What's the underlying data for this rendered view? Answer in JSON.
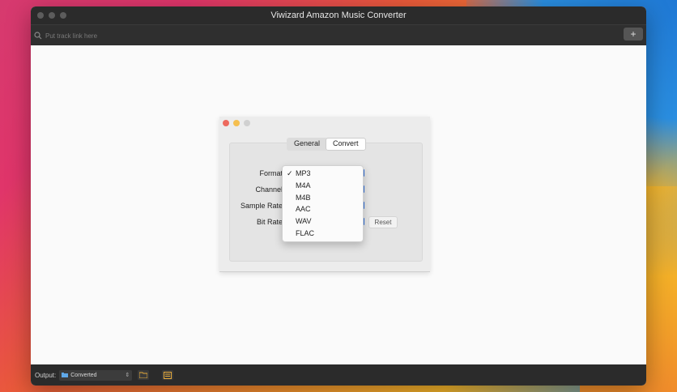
{
  "window": {
    "title": "Viwizard Amazon Music Converter"
  },
  "search": {
    "placeholder": "Put track link here",
    "add_icon": "plus-icon"
  },
  "prefs": {
    "tabs": [
      {
        "label": "General",
        "active": false
      },
      {
        "label": "Convert",
        "active": true
      }
    ],
    "rows": [
      {
        "label": "Format"
      },
      {
        "label": "Channel"
      },
      {
        "label": "Sample Rate"
      },
      {
        "label": "Bit Rate"
      }
    ],
    "reset_label": "Reset",
    "format_menu": {
      "selected": "MP3",
      "options": [
        {
          "label": "MP3",
          "checked": true
        },
        {
          "label": "M4A",
          "checked": false
        },
        {
          "label": "M4B",
          "checked": false
        },
        {
          "label": "AAC",
          "checked": false
        },
        {
          "label": "WAV",
          "checked": false
        },
        {
          "label": "FLAC",
          "checked": false
        }
      ]
    }
  },
  "bottom": {
    "output_label": "Output:",
    "output_folder": "Converted"
  },
  "colors": {
    "close": "#ed6a5e",
    "minimize": "#f5bf4f",
    "zoom": "#d0d0d0",
    "accent": "#2f6fdc"
  }
}
